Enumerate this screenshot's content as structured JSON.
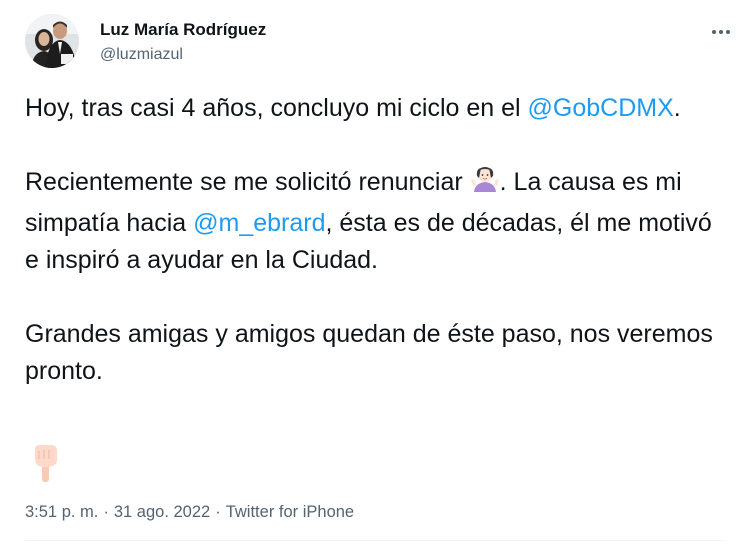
{
  "author": {
    "name": "Luz María Rodríguez",
    "handle": "@luzmiazul"
  },
  "tweet": {
    "p1_text": "Hoy, tras casi 4 años, concluyo mi ciclo en el ",
    "p1_mention": "@GobCDMX",
    "p1_end": ".",
    "p2_text1": "Recientemente se me solicitó renunciar ",
    "p2_text2": ". La causa es mi simpatía hacia ",
    "p2_mention": "@m_ebrard",
    "p2_text3": ", ésta es de décadas, él me motivó e inspiró a ayudar en la Ciudad.",
    "p3_text": "Grandes amigas y amigos quedan de éste paso, nos veremos pronto.",
    "emoji_inline": "person-shrugging-emoji",
    "emoji_footer": "pointing-down-hand-emoji"
  },
  "meta": {
    "time": "3:51 p. m.",
    "separator": "·",
    "date": "31 ago. 2022",
    "source": "Twitter for iPhone"
  },
  "colors": {
    "link": "#1d9bf0",
    "text": "#0f1419",
    "secondary": "#536471"
  }
}
